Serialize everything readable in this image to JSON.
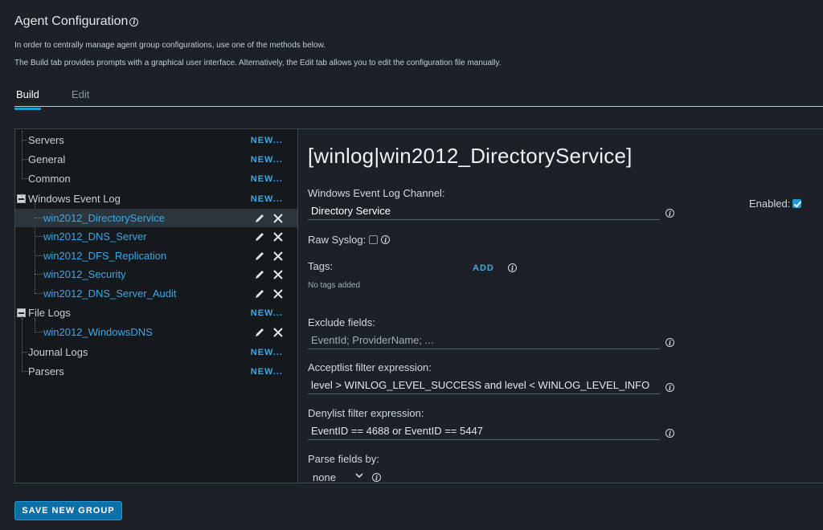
{
  "page": {
    "title": "Agent Configuration",
    "description_1": "In order to centrally manage agent group configurations, use one of the methods below.",
    "description_2": "The Build tab provides prompts with a graphical user interface. Alternatively, the Edit tab allows you to edit the configuration file manually."
  },
  "tabs": [
    {
      "label": "Build",
      "active": true
    },
    {
      "label": "Edit",
      "active": false
    }
  ],
  "tree": {
    "new_label": "NEW...",
    "items": [
      {
        "label": "Servers",
        "type": "section"
      },
      {
        "label": "General",
        "type": "section"
      },
      {
        "label": "Common",
        "type": "section"
      },
      {
        "label": "Windows Event Log",
        "type": "section",
        "expanded": true
      },
      {
        "label": "win2012_DirectoryService",
        "type": "child",
        "selected": true
      },
      {
        "label": "win2012_DNS_Server",
        "type": "child"
      },
      {
        "label": "win2012_DFS_Replication",
        "type": "child"
      },
      {
        "label": "win2012_Security",
        "type": "child"
      },
      {
        "label": "win2012_DNS_Server_Audit",
        "type": "child"
      },
      {
        "label": "File Logs",
        "type": "section",
        "expanded": true
      },
      {
        "label": "win2012_WindowsDNS",
        "type": "child"
      },
      {
        "label": "Journal Logs",
        "type": "section"
      },
      {
        "label": "Parsers",
        "type": "section"
      }
    ]
  },
  "main": {
    "heading": "[winlog|win2012_DirectoryService]",
    "channel_label": "Windows Event Log Channel:",
    "channel_value": "Directory Service",
    "enabled_label": "Enabled:",
    "enabled_checked": true,
    "raw_syslog_label": "Raw Syslog:",
    "raw_syslog_checked": false,
    "tags_label": "Tags:",
    "add_label": "ADD",
    "no_tags_text": "No tags added",
    "exclude_label": "Exclude fields:",
    "exclude_placeholder": "EventId; ProviderName; ...",
    "acceptlist_label": "Acceptlist filter expression:",
    "acceptlist_value": "level > WINLOG_LEVEL_SUCCESS and level < WINLOG_LEVEL_INFO",
    "denylist_label": "Denylist filter expression:",
    "denylist_value": "EventID == 4688 or EventID == 5447",
    "parse_label": "Parse fields by:",
    "parse_value": "none"
  },
  "footer": {
    "save_label": "SAVE NEW GROUP"
  },
  "colors": {
    "accent": "#1e9ad6",
    "link": "#3fa7e6",
    "background": "#1b2126",
    "tree_background": "#15191c",
    "selected_row": "#2b353d"
  }
}
